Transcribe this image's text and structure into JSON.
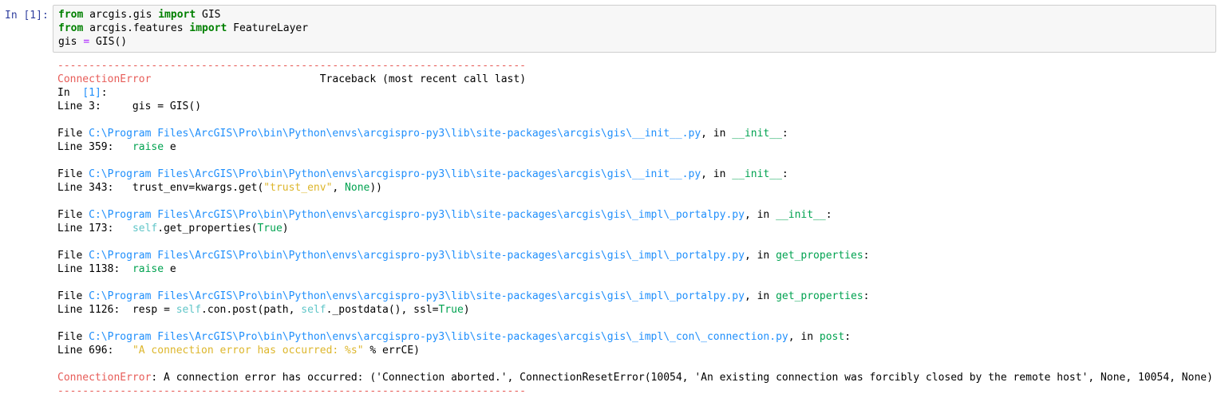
{
  "cell": {
    "prompt": "In [1]:",
    "code": {
      "line1": {
        "kw1": "from",
        "mod": " arcgis.gis ",
        "kw2": "import",
        "name": " GIS"
      },
      "line2": {
        "kw1": "from",
        "mod": " arcgis.features ",
        "kw2": "import",
        "name": " FeatureLayer"
      },
      "line3": {
        "lhs": "gis ",
        "eq": "=",
        "rhs": " GIS()"
      }
    }
  },
  "output": {
    "separator": "---------------------------------------------------------------------------",
    "header": {
      "error_name": "ConnectionError",
      "gap": "                           ",
      "traceback": "Traceback (most recent call last)"
    },
    "in_line": {
      "label": "In  ",
      "ref": "[1]",
      "colon": ":"
    },
    "line3": {
      "label": "Line 3:",
      "code": "     gis = GIS()"
    },
    "frames": [
      {
        "file_label": "File ",
        "path": "C:\\Program Files\\ArcGIS\\Pro\\bin\\Python\\envs\\arcgispro-py3\\lib\\site-packages\\arcgis\\gis\\__init__.py",
        "in_text": ", in ",
        "func": "__init__",
        "colon": ":",
        "line_label": "Line 359:",
        "code_pre": "   ",
        "code_kw": "raise",
        "code_post": " e"
      },
      {
        "file_label": "File ",
        "path": "C:\\Program Files\\ArcGIS\\Pro\\bin\\Python\\envs\\arcgispro-py3\\lib\\site-packages\\arcgis\\gis\\__init__.py",
        "in_text": ", in ",
        "func": "__init__",
        "colon": ":",
        "line_label": "Line 343:",
        "code_a": "   trust_env=kwargs.get(",
        "code_str": "\"trust_env\"",
        "code_b": ", ",
        "code_kw": "None",
        "code_c": "))"
      },
      {
        "file_label": "File ",
        "path": "C:\\Program Files\\ArcGIS\\Pro\\bin\\Python\\envs\\arcgispro-py3\\lib\\site-packages\\arcgis\\gis\\_impl\\_portalpy.py",
        "in_text": ", in ",
        "func": "__init__",
        "colon": ":",
        "line_label": "Line 173:",
        "code_pre": "   ",
        "code_self": "self",
        "code_a": ".get_properties(",
        "code_kw": "True",
        "code_b": ")"
      },
      {
        "file_label": "File ",
        "path": "C:\\Program Files\\ArcGIS\\Pro\\bin\\Python\\envs\\arcgispro-py3\\lib\\site-packages\\arcgis\\gis\\_impl\\_portalpy.py",
        "in_text": ", in ",
        "func": "get_properties",
        "colon": ":",
        "line_label": "Line 1138:",
        "code_pre": "  ",
        "code_kw": "raise",
        "code_post": " e"
      },
      {
        "file_label": "File ",
        "path": "C:\\Program Files\\ArcGIS\\Pro\\bin\\Python\\envs\\arcgispro-py3\\lib\\site-packages\\arcgis\\gis\\_impl\\_portalpy.py",
        "in_text": ", in ",
        "func": "get_properties",
        "colon": ":",
        "line_label": "Line 1126:",
        "code_a": "  resp = ",
        "code_self1": "self",
        "code_b": ".con.post(path, ",
        "code_self2": "self",
        "code_c": "._postdata(), ssl=",
        "code_kw": "True",
        "code_d": ")"
      },
      {
        "file_label": "File ",
        "path": "C:\\Program Files\\ArcGIS\\Pro\\bin\\Python\\envs\\arcgispro-py3\\lib\\site-packages\\arcgis\\gis\\_impl\\_con\\_connection.py",
        "in_text": ", in ",
        "func": "post",
        "colon": ":",
        "line_label": "Line 696:",
        "code_pre": "   ",
        "code_str": "\"A connection error has occurred: %s\"",
        "code_post": " % errCE)"
      }
    ],
    "final": {
      "error_name": "ConnectionError",
      "message": ": A connection error has occurred: ('Connection aborted.', ConnectionResetError(10054, 'An existing connection was forcibly closed by the remote host', None, 10054, None))"
    },
    "colors": {
      "error": "#e75c58",
      "path": "#208ffb",
      "func": "#00a250",
      "self": "#60c6c8",
      "string": "#ddb62b",
      "keyword": "#008000",
      "prompt": "#303f9f"
    }
  }
}
